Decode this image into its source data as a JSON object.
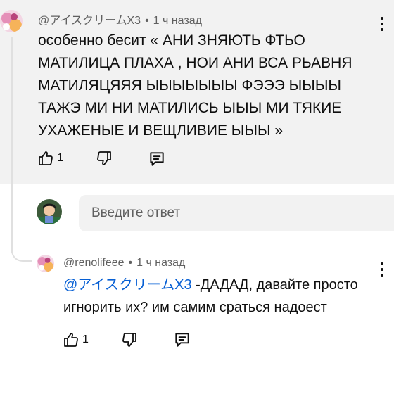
{
  "top_comment": {
    "author": "@アイスクリームX3",
    "separator": "•",
    "time": "1 ч назад",
    "lines": [
      "особенно бесит « АНИ ЗНЯЮТЬ ФТЬО",
      "МАТИЛИЦА ПЛАХА , НОИ АНИ ВСА РЬАВНЯ",
      "МАТИЛЯЦЯЯЯ ЫЫЫЫЫЫЫ ФЭЭЭ ЫЫЫЫ",
      "ТАЖЭ МИ НИ МАТИЛИСЬ ЫЫЫ МИ ТЯКИЕ",
      "УХАЖЕНЫЕ И ВЕЩЛИВИЕ ЫЫЫ »"
    ],
    "like_count": "1"
  },
  "reply_box": {
    "placeholder": "Введите ответ"
  },
  "reply": {
    "author": "@renolifeee",
    "separator": "•",
    "time": "1 ч назад",
    "mention": "@アイスクリームX3",
    "line1_rest": " -ДАДАД, давайте просто",
    "line2": "игнорить их? им самим сраться надоест",
    "like_count": "1"
  },
  "icons": {
    "like": "thumbs-up-icon",
    "dislike": "thumbs-down-icon",
    "reply": "comment-reply-icon",
    "more": "more-vertical-icon"
  },
  "colors": {
    "mention": "#065fd4",
    "highlight_bg": "#f2f2f2",
    "meta_text": "#606060"
  }
}
